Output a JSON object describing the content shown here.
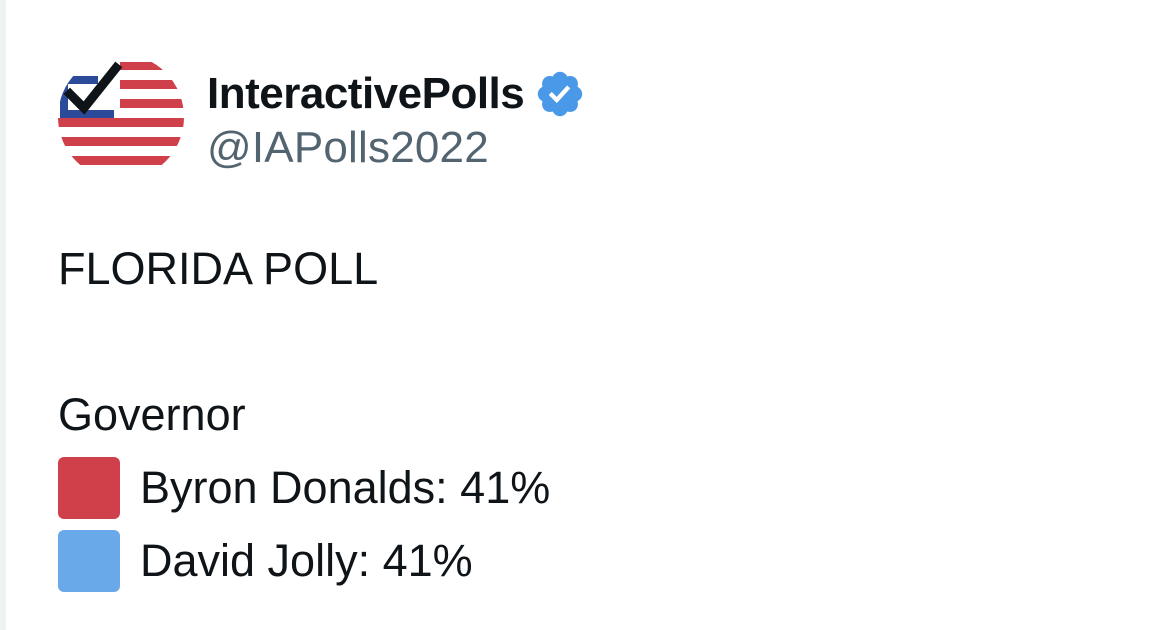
{
  "account": {
    "display_name": "InteractivePolls",
    "handle": "@IAPolls2022",
    "verified": true,
    "verified_color": "#4a99e9",
    "avatar_icon": "poll-checkbox-flag-icon"
  },
  "tweet": {
    "heading": "FLORIDA POLL",
    "race": "Governor",
    "results": [
      {
        "icon": "red-square-emoji",
        "color": "#d0404a",
        "label": "Byron Donalds: 41%"
      },
      {
        "icon": "blue-square-emoji",
        "color": "#6aa9e9",
        "label": "David Jolly: 41%"
      }
    ]
  }
}
